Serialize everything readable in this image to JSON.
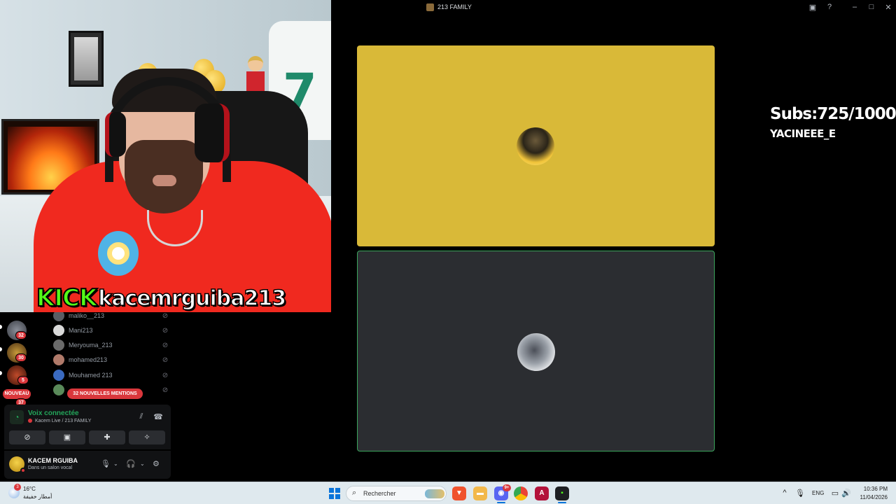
{
  "stream_window": {
    "title": "213 FAMILY",
    "subs_text": "Subs:725/1000",
    "streamer_name": "YACINEEE_E"
  },
  "webcam": {
    "kick_logo": "KICK",
    "kick_username": "kacemrguiba213"
  },
  "servers": [
    {
      "badge": "32"
    },
    {
      "badge": "30"
    },
    {
      "badge": "5"
    }
  ],
  "servers_new_label": "NOUVEAU",
  "servers_new_count": "37",
  "members": [
    {
      "name": "maliko__213"
    },
    {
      "name": "Mani213"
    },
    {
      "name": "Meryouma_213"
    },
    {
      "name": "mohamed213"
    },
    {
      "name": "Mouhamed 213"
    }
  ],
  "mentions_label": "32 NOUVELLES MENTIONS",
  "voice": {
    "status": "Voix connectée",
    "channel": "Kacem Live / 213 FAMILY"
  },
  "user": {
    "name": "KACEM RGUIBA",
    "status": "Dans un salon vocal"
  },
  "taskbar": {
    "weather_badge": "3",
    "temperature": "16°C",
    "weather_desc": "أمطار خفيفة",
    "search_placeholder": "Rechercher",
    "discord_badge": "9+",
    "language": "ENG",
    "time": "10:36 PM",
    "date": "11/04/2026"
  },
  "colors": {
    "accent_green": "#23a55a",
    "tile_yellow": "#d9b938",
    "tile_dark": "#2b2d31",
    "mention_red": "#da373c",
    "kick_green": "#53fc18"
  }
}
